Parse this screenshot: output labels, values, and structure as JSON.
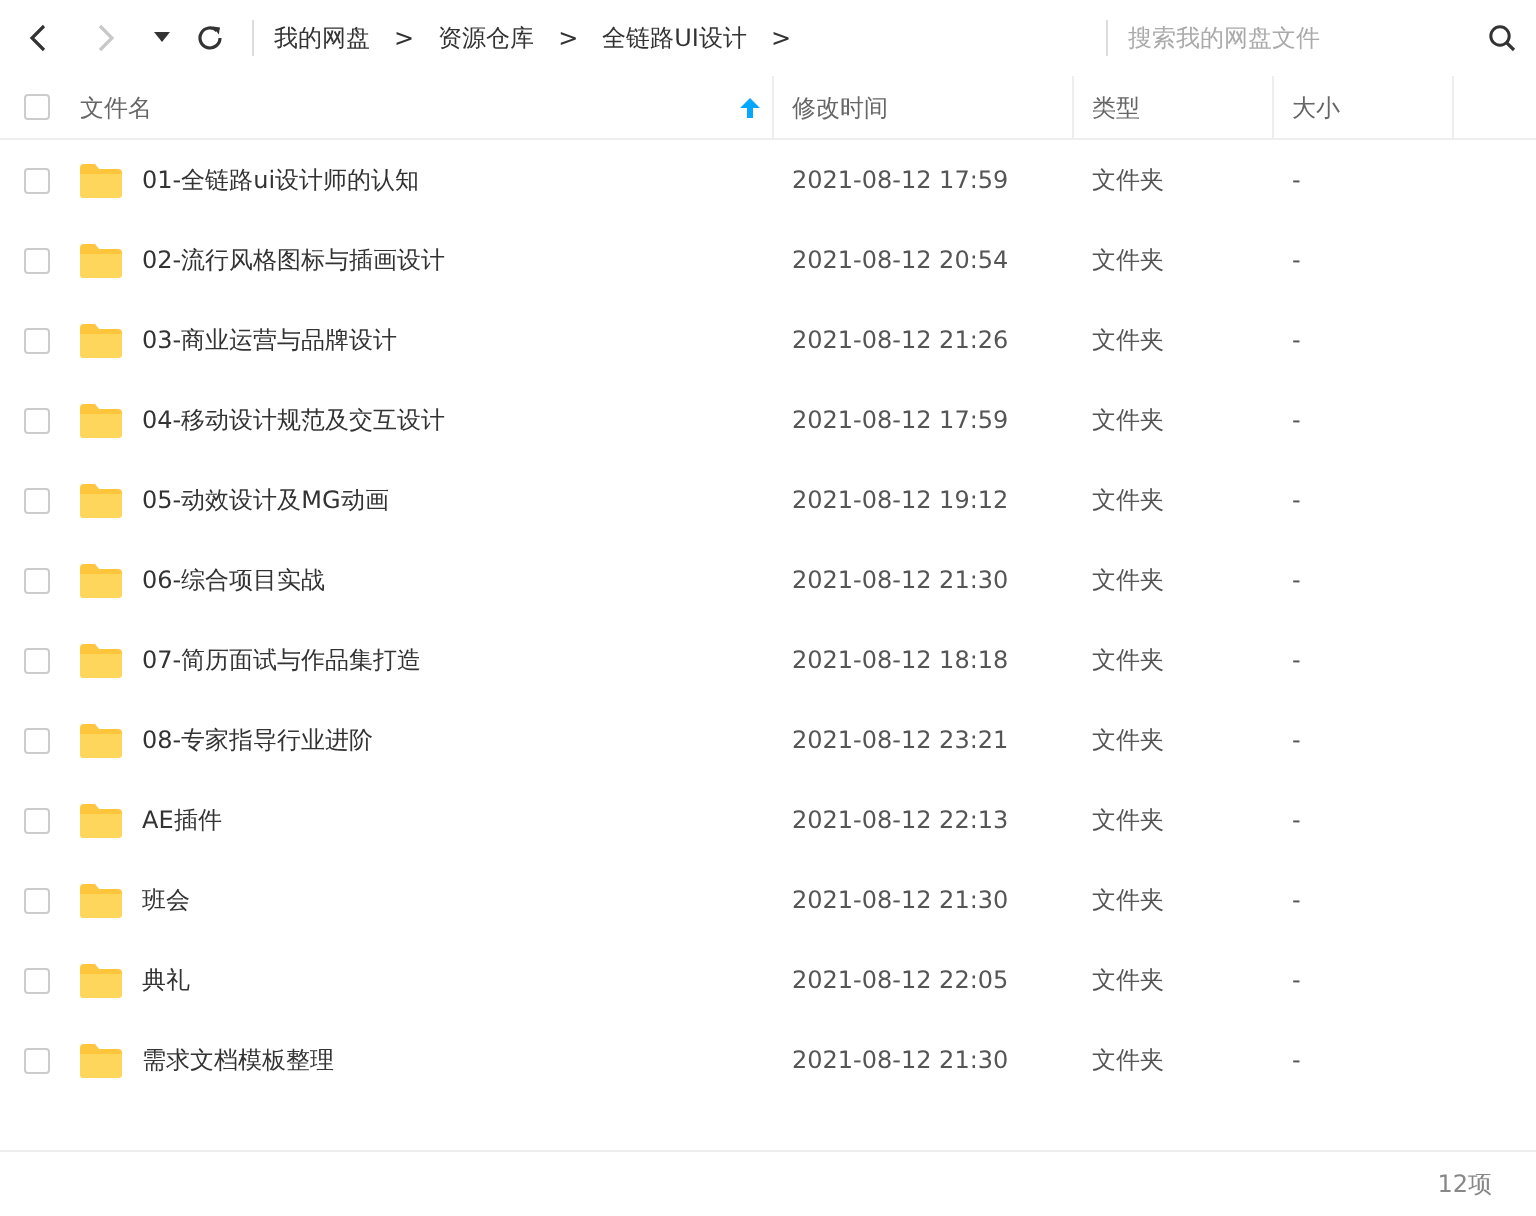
{
  "toolbar": {
    "back": {
      "disabled": false
    },
    "forward": {
      "disabled": true
    },
    "breadcrumbs": [
      {
        "label": "我的网盘",
        "separator": ">"
      },
      {
        "label": "资源仓库",
        "separator": ">"
      },
      {
        "label": "全链路UI设计",
        "separator": ">"
      }
    ],
    "search": {
      "placeholder": "搜索我的网盘文件"
    }
  },
  "select_all": {
    "checked": false
  },
  "columns": [
    {
      "label": "文件名",
      "sorted": true
    },
    {
      "label": "修改时间",
      "sorted": false
    },
    {
      "label": "类型",
      "sorted": false
    },
    {
      "label": "大小",
      "sorted": false
    }
  ],
  "rows": [
    {
      "name": "01-全链路ui设计师的认知",
      "modified": "2021-08-12 17:59",
      "type": "文件夹",
      "size": "-",
      "checked": false
    },
    {
      "name": "02-流行风格图标与插画设计",
      "modified": "2021-08-12 20:54",
      "type": "文件夹",
      "size": "-",
      "checked": false
    },
    {
      "name": "03-商业运营与品牌设计",
      "modified": "2021-08-12 21:26",
      "type": "文件夹",
      "size": "-",
      "checked": false
    },
    {
      "name": "04-移动设计规范及交互设计",
      "modified": "2021-08-12 17:59",
      "type": "文件夹",
      "size": "-",
      "checked": false
    },
    {
      "name": "05-动效设计及MG动画",
      "modified": "2021-08-12 19:12",
      "type": "文件夹",
      "size": "-",
      "checked": false
    },
    {
      "name": "06-综合项目实战",
      "modified": "2021-08-12 21:30",
      "type": "文件夹",
      "size": "-",
      "checked": false
    },
    {
      "name": "07-简历面试与作品集打造",
      "modified": "2021-08-12 18:18",
      "type": "文件夹",
      "size": "-",
      "checked": false
    },
    {
      "name": "08-专家指导行业进阶",
      "modified": "2021-08-12 23:21",
      "type": "文件夹",
      "size": "-",
      "checked": false
    },
    {
      "name": "AE插件",
      "modified": "2021-08-12 22:13",
      "type": "文件夹",
      "size": "-",
      "checked": false
    },
    {
      "name": "班会",
      "modified": "2021-08-12 21:30",
      "type": "文件夹",
      "size": "-",
      "checked": false
    },
    {
      "name": "典礼",
      "modified": "2021-08-12 22:05",
      "type": "文件夹",
      "size": "-",
      "checked": false
    },
    {
      "name": "需求文档模板整理",
      "modified": "2021-08-12 21:30",
      "type": "文件夹",
      "size": "-",
      "checked": false
    }
  ],
  "status_bar": {
    "count": "12项"
  }
}
